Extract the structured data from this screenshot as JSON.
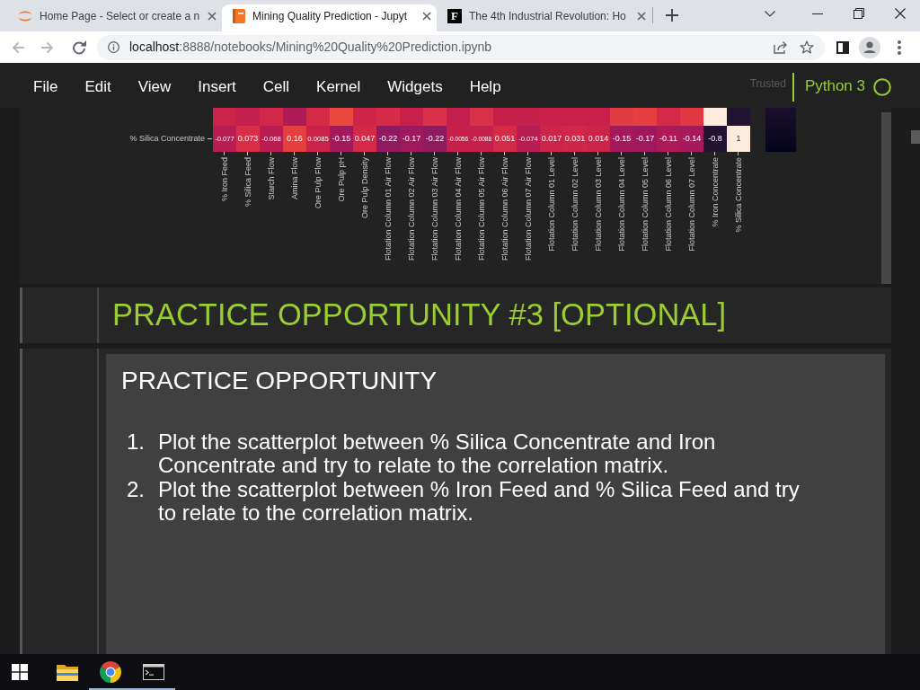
{
  "browser": {
    "tabs": [
      {
        "favicon": {
          "kind": "arcs"
        },
        "title": "Home Page - Select or create a n",
        "selected": false
      },
      {
        "favicon": {
          "kind": "book"
        },
        "title": "Mining Quality Prediction - Jupyt",
        "selected": true
      },
      {
        "favicon": {
          "kind": "letter",
          "text": "F"
        },
        "title": "The 4th Industrial Revolution: Ho",
        "selected": false
      }
    ],
    "url": {
      "host": "localhost",
      "path": ":8888/notebooks/Mining%20Quality%20Prediction.ipynb"
    }
  },
  "menubar": {
    "items": [
      "File",
      "Edit",
      "View",
      "Insert",
      "Cell",
      "Kernel",
      "Widgets",
      "Help"
    ],
    "trust_label": "Trusted",
    "kernel": {
      "name": "Python 3",
      "busy": false
    }
  },
  "heatmap": {
    "partial_row": [
      {
        "color": "#cc2449"
      },
      {
        "color": "#c21e4e"
      },
      {
        "color": "#d22848"
      },
      {
        "color": "#ad1a56"
      },
      {
        "color": "#d52b47"
      },
      {
        "color": "#ea4a3e"
      },
      {
        "color": "#ce2549"
      },
      {
        "color": "#d52b47"
      },
      {
        "color": "#c81f4b"
      },
      {
        "color": "#d93147"
      },
      {
        "color": "#c21e4e"
      },
      {
        "color": "#d93147"
      },
      {
        "color": "#c51f4c"
      },
      {
        "color": "#c51f4c"
      },
      {
        "color": "#c81f4b"
      },
      {
        "color": "#c81f4b"
      },
      {
        "color": "#c81f4b"
      },
      {
        "color": "#e03a43"
      },
      {
        "color": "#e43e41"
      },
      {
        "color": "#d42a48"
      },
      {
        "color": "#df3843"
      },
      {
        "color": "#faebdd"
      },
      {
        "color": "#211430"
      }
    ],
    "rows": [
      {
        "label": "% Silica Concentrate",
        "cells": [
          {
            "value": "-0.077",
            "color": "#b81c52"
          },
          {
            "value": "0.073",
            "color": "#d82e47"
          },
          {
            "value": "-0.068",
            "color": "#ba1c51"
          },
          {
            "value": "0.16",
            "color": "#e5403f"
          },
          {
            "value": "0.0085",
            "color": "#cb2249"
          },
          {
            "value": "-0.15",
            "color": "#a3195b"
          },
          {
            "value": "0.047",
            "color": "#d42a48"
          },
          {
            "value": "-0.22",
            "color": "#8f1a5f"
          },
          {
            "value": "-0.17",
            "color": "#9d185d"
          },
          {
            "value": "-0.22",
            "color": "#8f1a5f"
          },
          {
            "value": "-0.0056",
            "color": "#c71f4b"
          },
          {
            "value": "-0.0088",
            "color": "#c51f4c"
          },
          {
            "value": "0.051",
            "color": "#d32a48"
          },
          {
            "value": "-0.074",
            "color": "#b81c52"
          },
          {
            "value": "0.017",
            "color": "#cd2449"
          },
          {
            "value": "0.031",
            "color": "#d02648"
          },
          {
            "value": "0.014",
            "color": "#cc2449"
          },
          {
            "value": "-0.15",
            "color": "#a3195b"
          },
          {
            "value": "-0.17",
            "color": "#9d185d"
          },
          {
            "value": "-0.11",
            "color": "#ad1a56"
          },
          {
            "value": "-0.14",
            "color": "#a6195a"
          },
          {
            "value": "-0.8",
            "color": "#221330"
          },
          {
            "value": "1",
            "color": "#faebdd"
          }
        ]
      }
    ],
    "x_axis_labels": [
      "% Iron Feed",
      "% Silica Feed",
      "Starch Flow",
      "Amina Flow",
      "Ore Pulp Flow",
      "Ore Pulp pH",
      "Ore Pulp Density",
      "Flotation Column 01 Air Flow",
      "Flotation Column 02 Air Flow",
      "Flotation Column 03 Air Flow",
      "Flotation Column 04 Air Flow",
      "Flotation Column 05 Air Flow",
      "Flotation Column 06 Air Flow",
      "Flotation Column 07 Air Flow",
      "Flotation Column 01 Level",
      "Flotation Column 02 Level",
      "Flotation Column 03 Level",
      "Flotation Column 04 Level",
      "Flotation Column 05 Level",
      "Flotation Column 06 Level",
      "Flotation Column 07 Level",
      "% Iron Concentrate",
      "% Silica Concentrate"
    ]
  },
  "cells": [
    {
      "kind": "heading",
      "text": "PRACTICE OPPORTUNITY #3 [OPTIONAL]"
    },
    {
      "kind": "panel",
      "title": "PRACTICE OPPORTUNITY",
      "items": [
        {
          "number": "1.",
          "text": "Plot the scatterplot between % Silica Concentrate and Iron Concentrate and try to relate to the correlation matrix."
        },
        {
          "number": "2.",
          "text": "Plot the scatterplot between % Iron Feed and % Silica Feed and try to relate to the correlation matrix."
        }
      ]
    }
  ],
  "taskbar": {
    "apps": [
      {
        "kind": "explorer",
        "running": false
      },
      {
        "kind": "chrome",
        "running": true
      },
      {
        "kind": "terminal",
        "running": true
      }
    ]
  }
}
